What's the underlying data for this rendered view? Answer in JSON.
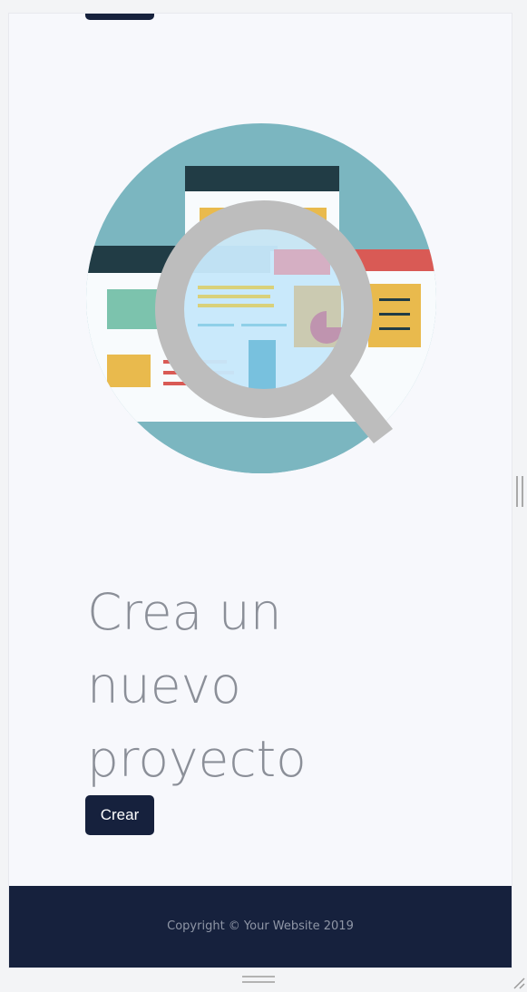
{
  "hero": {
    "icon": "magnifier-search-icon",
    "colors": {
      "background": "#7bb6c0",
      "dark_bar": "#213c45",
      "paper": "#f8fbfd",
      "yellow": "#e9ba4d",
      "green": "#7cc3ad",
      "red": "#d95a55",
      "light_blue": "#c7e8fb",
      "magnifier": "#bdbdbd"
    }
  },
  "title": {
    "line_1": "Crea un",
    "line_2": "nuevo",
    "line_3": "proyecto"
  },
  "actions": {
    "create_label": "Crear"
  },
  "footer": {
    "copyright": "Copyright © Your Website 2019"
  },
  "colors": {
    "navy": "#16213d",
    "title_gray": "#8b8f98",
    "page_background": "#f7f8fc"
  }
}
